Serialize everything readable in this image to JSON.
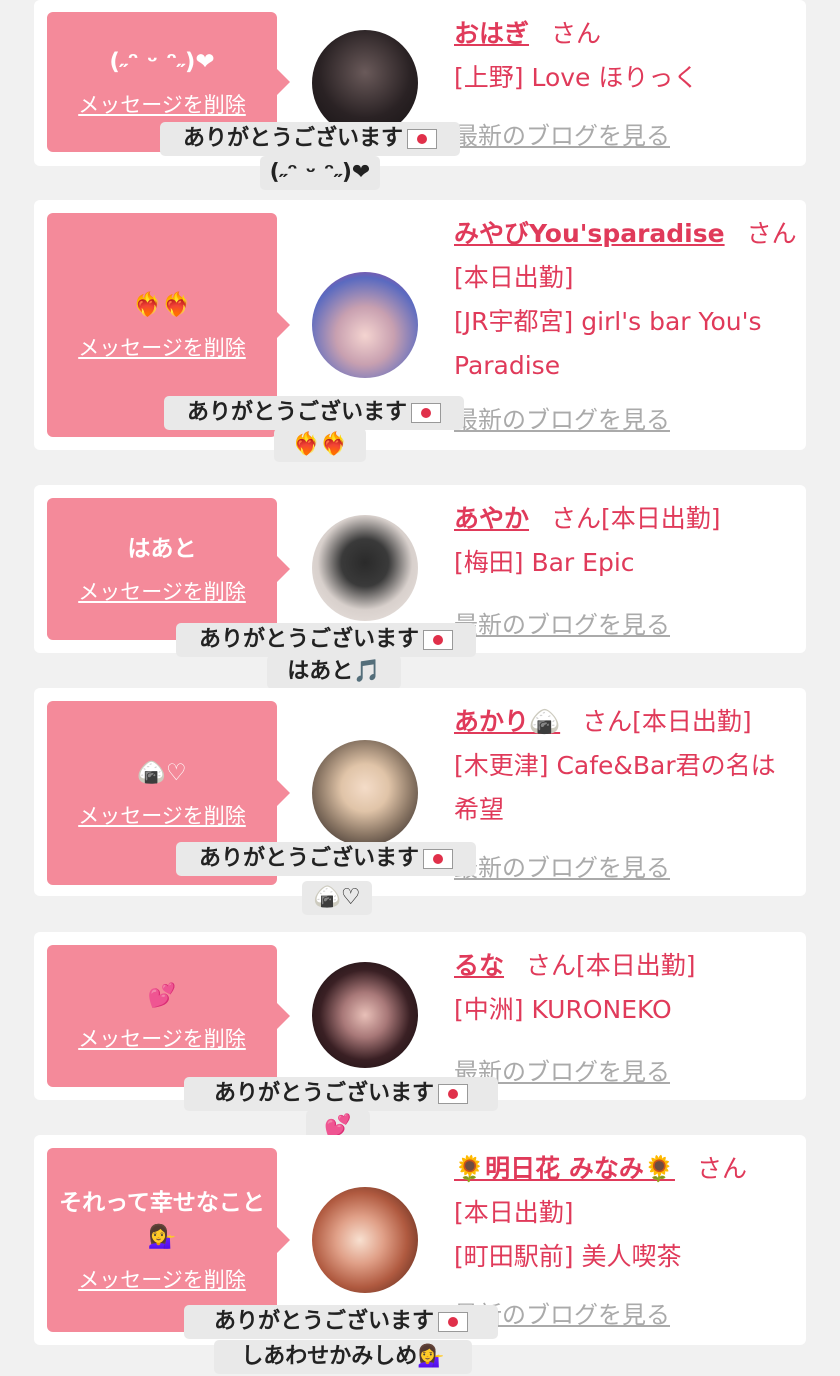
{
  "common": {
    "delete_label": "メッセージを削除",
    "blog_label": "最新のブログを見る",
    "thanks_label": "ありがとうございます"
  },
  "cards": [
    {
      "bubble_text": "(˶ᵔ ᵕ ᵔ˶)❤",
      "name": "おはぎ",
      "san": "さん",
      "tag": "",
      "shop": "[上野] Love ほりっく",
      "reply": "(˶ᵔ ᵕ ᵔ˶)❤"
    },
    {
      "bubble_text": "❤️‍🔥❤️‍🔥",
      "name": "みやびYou'sparadise",
      "san": "さん",
      "tag": "[本日出勤]",
      "shop": "[JR宇都宮] girl's bar You's Paradise",
      "reply": "❤️‍🔥❤️‍🔥"
    },
    {
      "bubble_text": "はあと",
      "name": "あやか",
      "san": "さん",
      "tag": "[本日出勤]",
      "shop": "[梅田] Bar Epic",
      "reply": "はあと🎵"
    },
    {
      "bubble_text": "🍙♡",
      "name": "あかり🍙",
      "san": "さん",
      "tag": "[本日出勤]",
      "shop": "[木更津] Cafe&Bar君の名は希望",
      "reply": "🍙♡"
    },
    {
      "bubble_text": "💕",
      "name": "るな",
      "san": "さん",
      "tag": "[本日出勤]",
      "shop": "[中洲] KURONEKO",
      "reply": "💕"
    },
    {
      "bubble_text": "それって幸せなこと💁‍♀️",
      "name": "🌻明日花 みなみ🌻",
      "san": "さん",
      "tag": "[本日出勤]",
      "shop": "[町田駅前] 美人喫茶",
      "reply": "しあわせかみしめ💁‍♀️"
    }
  ],
  "colors": {
    "accent": "#e03a5a",
    "bubble": "#f48a9a",
    "background": "#f1f1f1"
  }
}
